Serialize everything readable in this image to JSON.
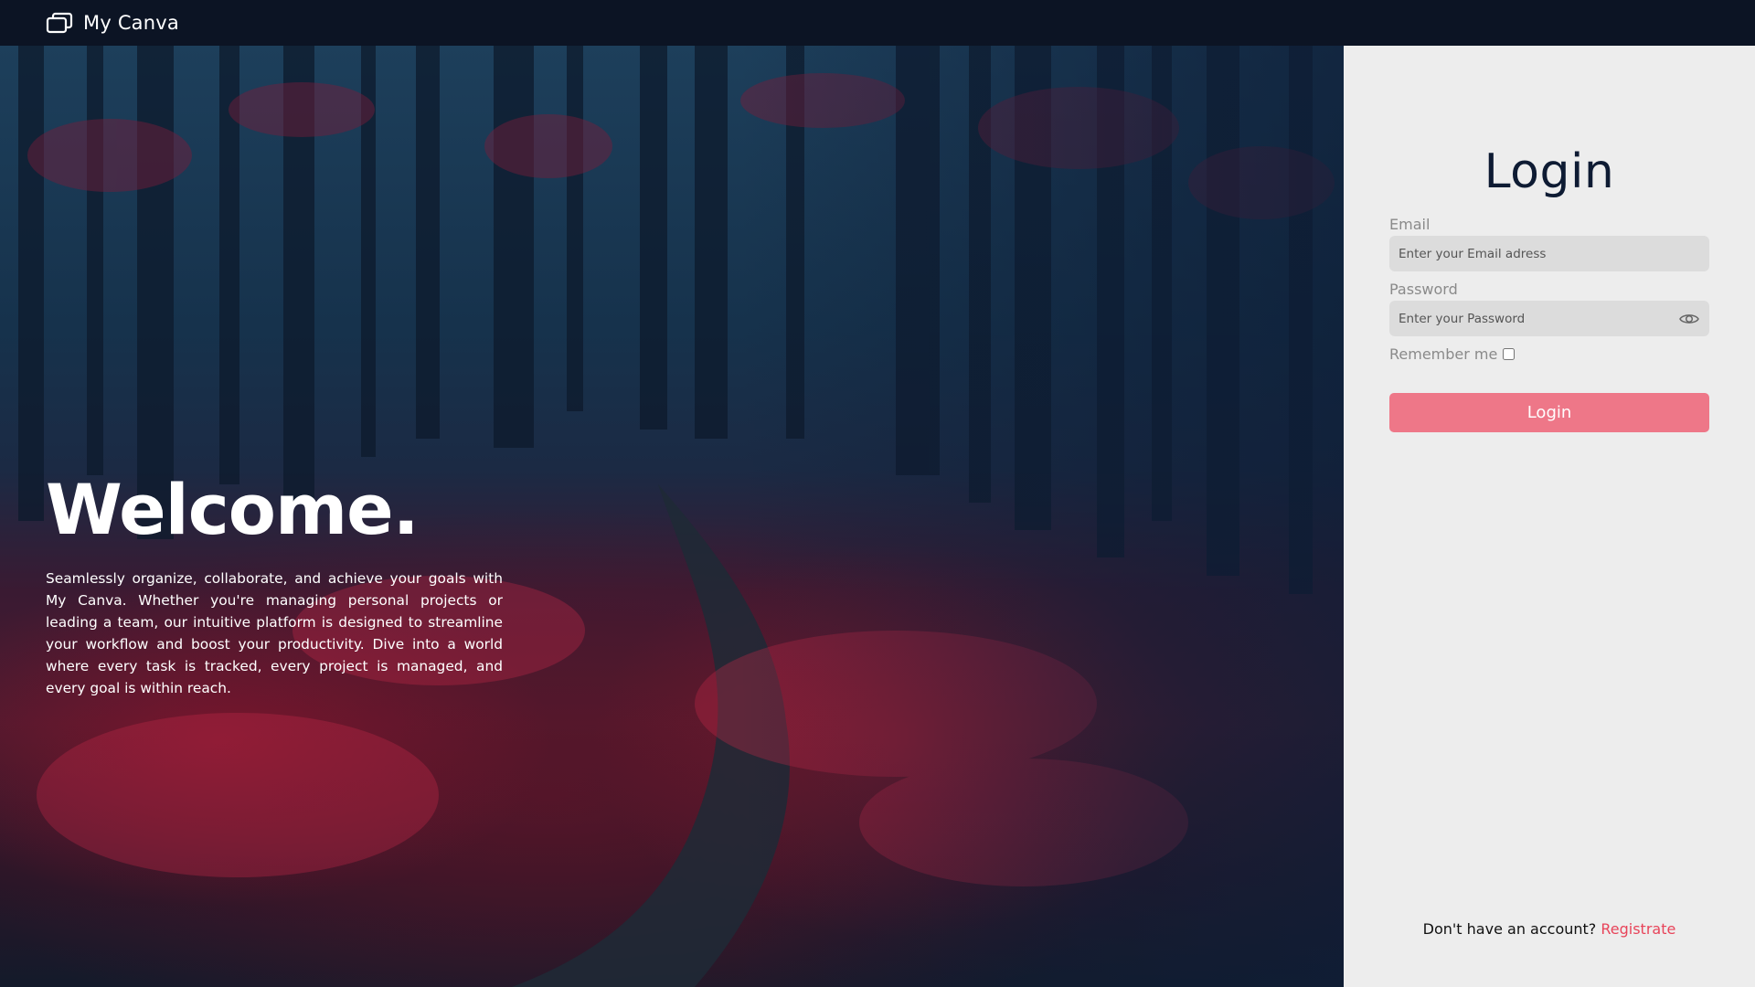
{
  "app": {
    "name": "My Canva",
    "logo_icon": "windows-stack-icon"
  },
  "hero": {
    "title": "Welcome.",
    "text": "Seamlessly organize, collaborate, and achieve your goals with My Canva. Whether you're managing personal projects or leading a team, our intuitive platform is designed to streamline your workflow and boost your productivity. Dive into a world where every task is tracked, every project is managed, and every goal is within reach."
  },
  "login": {
    "title": "Login",
    "email_label": "Email",
    "email_placeholder": "Enter your Email adress",
    "email_value": "",
    "password_label": "Password",
    "password_placeholder": "Enter your Password",
    "password_value": "",
    "password_toggle_icon": "eye-icon",
    "remember_label": "Remember me",
    "remember_checked": false,
    "submit_label": "Login",
    "no_account_text": "Don't have an account?",
    "register_label": "Registrate"
  },
  "colors": {
    "navbar_bg": "#0c1424",
    "panel_bg": "#ededed",
    "input_bg": "#dcdcdc",
    "button_bg": "#ee7788",
    "link": "#e8445a",
    "title": "#0e1b33"
  }
}
